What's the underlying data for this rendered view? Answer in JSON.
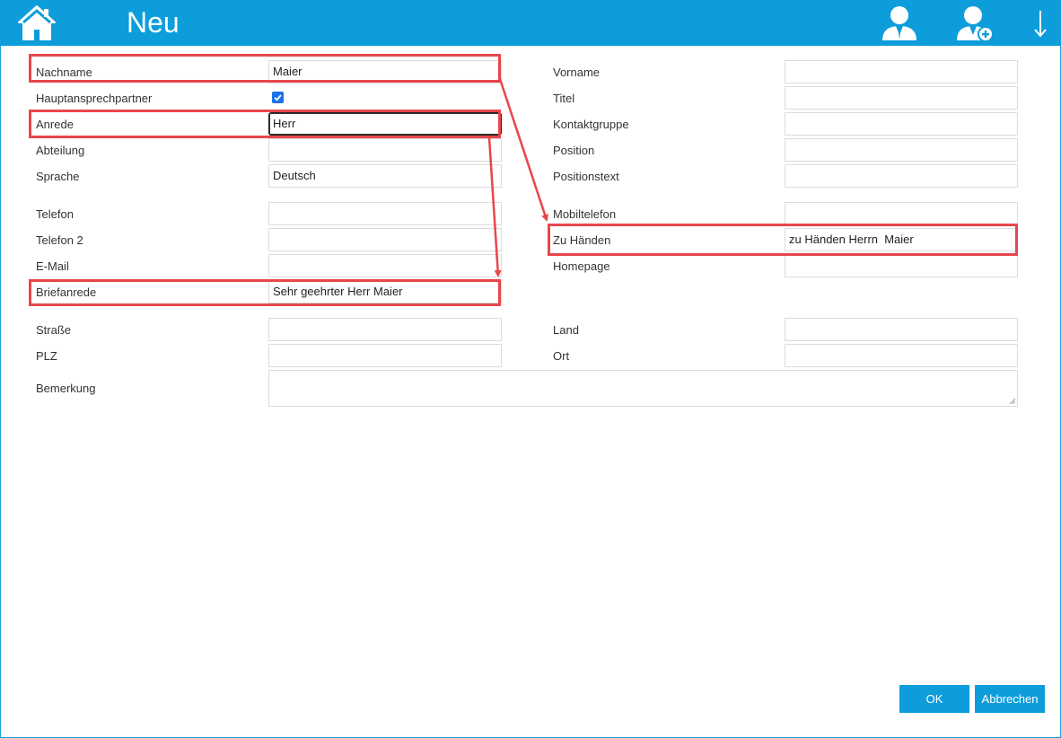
{
  "header": {
    "title": "Neu",
    "icons": {
      "home": "home-icon",
      "contact": "contact-person-icon",
      "add_contact": "add-contact-icon",
      "download": "arrow-down-icon"
    }
  },
  "form": {
    "left": {
      "nachname": {
        "label": "Nachname",
        "value": "Maier"
      },
      "hauptansprechpartner": {
        "label": "Hauptansprechpartner",
        "checked": true
      },
      "anrede": {
        "label": "Anrede",
        "value": "Herr"
      },
      "abteilung": {
        "label": "Abteilung",
        "value": ""
      },
      "sprache": {
        "label": "Sprache",
        "value": "Deutsch"
      },
      "telefon": {
        "label": "Telefon",
        "value": ""
      },
      "telefon2": {
        "label": "Telefon 2",
        "value": ""
      },
      "email": {
        "label": "E-Mail",
        "value": ""
      },
      "briefanrede": {
        "label": "Briefanrede",
        "value": "Sehr geehrter Herr Maier"
      },
      "strasse": {
        "label": "Straße",
        "value": ""
      },
      "plz": {
        "label": "PLZ",
        "value": ""
      },
      "bemerkung": {
        "label": "Bemerkung",
        "value": ""
      }
    },
    "right": {
      "vorname": {
        "label": "Vorname",
        "value": ""
      },
      "titel": {
        "label": "Titel",
        "value": ""
      },
      "kontaktgruppe": {
        "label": "Kontaktgruppe",
        "value": ""
      },
      "position": {
        "label": "Position",
        "value": ""
      },
      "positionstext": {
        "label": "Positionstext",
        "value": ""
      },
      "mobiltelefon": {
        "label": "Mobiltelefon",
        "value": ""
      },
      "zu_haenden": {
        "label": "Zu Händen",
        "value": "zu Händen Herrn  Maier"
      },
      "homepage": {
        "label": "Homepage",
        "value": ""
      },
      "land": {
        "label": "Land",
        "value": ""
      },
      "ort": {
        "label": "Ort",
        "value": ""
      }
    }
  },
  "buttons": {
    "ok": "OK",
    "cancel": "Abbrechen"
  },
  "colors": {
    "header_bg": "#0d9ddb",
    "highlight": "#e8464b",
    "checkbox": "#1a73e8"
  }
}
